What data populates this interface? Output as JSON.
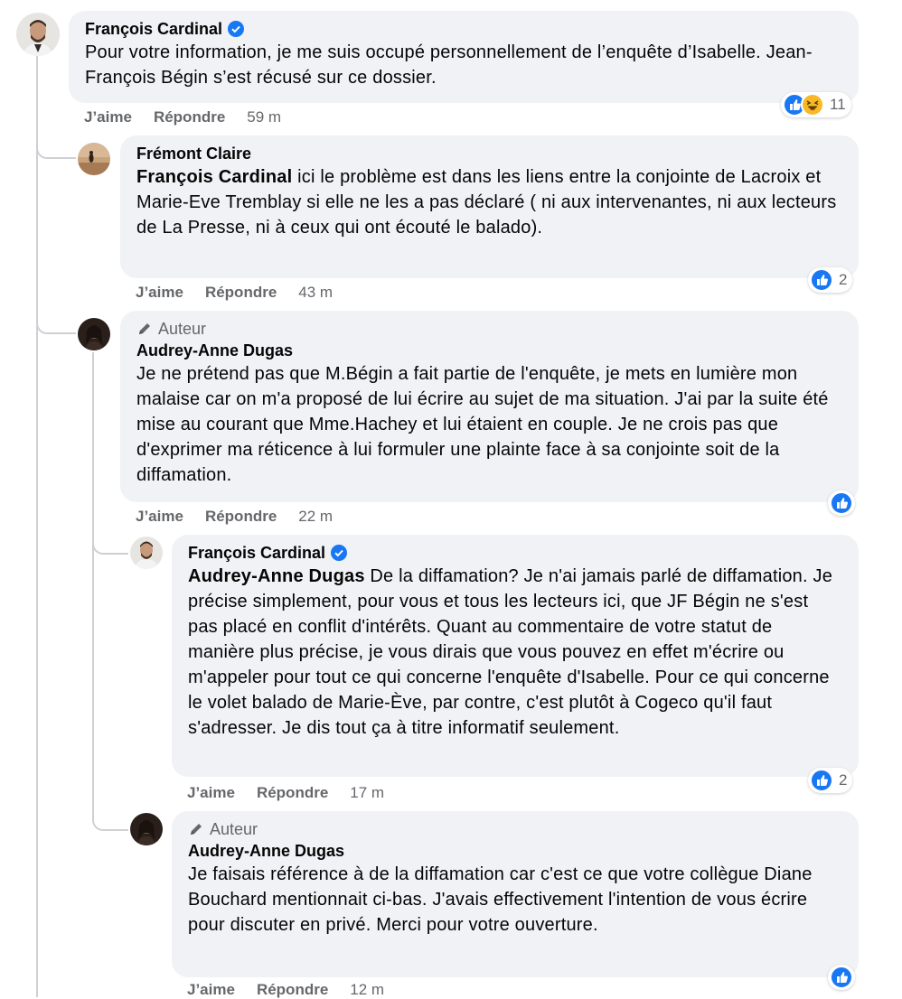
{
  "comments": [
    {
      "id": "c1",
      "name": "François Cardinal",
      "verified": true,
      "author": false,
      "text": "Pour votre information, je me suis occupé personnellement de l’enquête d’Isabelle. Jean-François Bégin s’est récusé sur ce dossier.",
      "like": "J’aime",
      "reply": "Répondre",
      "time": "59 m",
      "reactions": [
        "like",
        "haha"
      ],
      "reaction_count": "11"
    },
    {
      "id": "c2",
      "name": "Frémont Claire",
      "verified": false,
      "author": false,
      "mention": "François Cardinal",
      "text": " ici le problème est dans les liens entre la conjointe de Lacroix et Marie-Eve Tremblay si elle ne les a pas déclaré ( ni aux intervenantes, ni aux lecteurs de La Presse, ni à ceux qui ont écouté le balado).",
      "like": "J’aime",
      "reply": "Répondre",
      "time": "43 m",
      "reactions": [
        "like"
      ],
      "reaction_count": "2"
    },
    {
      "id": "c3",
      "author_label": "Auteur",
      "name": "Audrey-Anne Dugas",
      "verified": false,
      "author": true,
      "text": "Je ne prétend pas que M.Bégin a fait partie de l'enquête, je mets en lumière mon malaise car on m'a proposé de lui écrire au sujet de ma situation. J'ai par la suite été mise au courant que Mme.Hachey et lui étaient en couple. Je ne crois pas que d'exprimer ma réticence à lui formuler une plainte face à sa conjointe soit de la diffamation.",
      "like": "J’aime",
      "reply": "Répondre",
      "time": "22 m",
      "reactions": [
        "like"
      ],
      "reaction_count": ""
    },
    {
      "id": "c4",
      "name": "François Cardinal",
      "verified": true,
      "author": false,
      "mention": "Audrey-Anne Dugas",
      "text": " De la diffamation? Je n'ai jamais parlé de diffamation. Je précise simplement, pour vous et tous les lecteurs ici, que JF Bégin ne s'est pas placé en conflit d'intérêts. Quant au commentaire de votre statut de manière plus précise, je vous dirais que vous pouvez en effet m'écrire ou m'appeler pour tout ce qui concerne l'enquête d'Isabelle. Pour ce qui concerne le volet balado de Marie-Ève, par contre, c'est plutôt à Cogeco qu'il faut s'adresser. Je dis tout ça à titre informatif seulement.",
      "like": "J’aime",
      "reply": "Répondre",
      "time": "17 m",
      "reactions": [
        "like"
      ],
      "reaction_count": "2"
    },
    {
      "id": "c5",
      "author_label": "Auteur",
      "name": "Audrey-Anne Dugas",
      "verified": false,
      "author": true,
      "text": "Je faisais référence à de la diffamation car c'est ce que votre collègue Diane Bouchard mentionnait ci-bas. J'avais effectivement l'intention de vous écrire pour discuter en privé. Merci pour votre ouverture.",
      "like": "J’aime",
      "reply": "Répondre",
      "time": "12 m",
      "reactions": [
        "like"
      ],
      "reaction_count": ""
    }
  ],
  "colors": {
    "bubble": "#f0f2f5",
    "secondary_text": "#65676b",
    "like_blue": "#1877f2",
    "haha_yellow": "#f7b928",
    "thread_line": "#ced0d4"
  }
}
